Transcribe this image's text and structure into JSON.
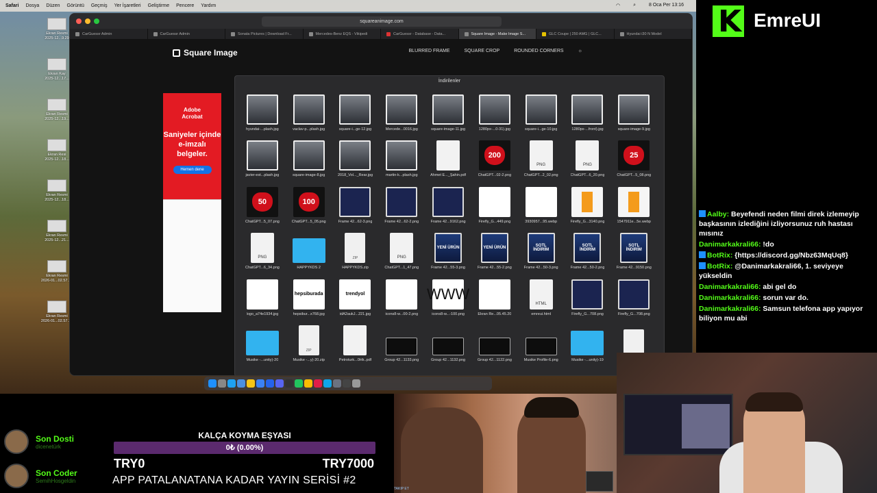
{
  "menubar": {
    "items": [
      "Safari",
      "Dosya",
      "Düzen",
      "Görüntü",
      "Geçmiş",
      "Yer İşaretleri",
      "Geliştirme",
      "Pencere",
      "Yardım"
    ],
    "clock": "8 Oca Per 13:16"
  },
  "desktop_icons": [
    {
      "label": ""
    },
    {
      "label": "Ekran Resmi\n2025-12...9.29"
    },
    {
      "label": "Ekran Kay\n2025-12...17..."
    },
    {
      "label": "Ekran Resmi\n2025-12...19..."
    },
    {
      "label": "Ekran Resi\n2025-12...18..."
    },
    {
      "label": "Ekran Resmi\n2025-12...18..."
    },
    {
      "label": "Ekran Resmi\n2025-12...21..."
    },
    {
      "label": "Ekran Resmi\n2026-01...02.57.19"
    },
    {
      "label": "Ekran Resmi\n2026-01...02.57.16"
    }
  ],
  "browser": {
    "url": "squareanimage.com",
    "tabs": [
      {
        "label": "CarGuessr Admin",
        "active": false
      },
      {
        "label": "CarGuessr Admin",
        "active": false
      },
      {
        "label": "Sonata Pictures | Download Fr...",
        "active": false
      },
      {
        "label": "Mercedes-Benz EQS - Vikipedi",
        "active": false
      },
      {
        "label": "CarGuessr - Database - Data...",
        "active": false
      },
      {
        "label": "Square Image - Make Image S...",
        "active": true
      },
      {
        "label": "GLC Coupe | 250 AMG | GLC...",
        "active": false
      },
      {
        "label": "Hyundai i30 N Model",
        "active": false
      }
    ]
  },
  "site": {
    "logo": "Square Image",
    "nav": [
      "BLURRED FRAME",
      "SQUARE CROP",
      "ROUNDED CORNERS"
    ]
  },
  "ad": {
    "brand": "Adobe\nAcrobat",
    "headline": "Saniyeler içinde e-imzalı belgeler.",
    "cta": "Hemen dene"
  },
  "downloads": {
    "title": "İndirilenler",
    "items": [
      {
        "name": "hyundai-...plash.jpg",
        "kind": "photo"
      },
      {
        "name": "vaclav-p...plash.jpg",
        "kind": "photo"
      },
      {
        "name": "square-i...ge-12.jpg",
        "kind": "photo"
      },
      {
        "name": "Mercede...0016.jpg",
        "kind": "photo"
      },
      {
        "name": "square-image-11.jpg",
        "kind": "photo"
      },
      {
        "name": "1280px-...0-31).jpg",
        "kind": "photo"
      },
      {
        "name": "square-i...ge-10.jpg",
        "kind": "photo"
      },
      {
        "name": "1280px-...front).jpg",
        "kind": "photo"
      },
      {
        "name": "square-image-9.jpg",
        "kind": "photo"
      },
      {
        "name": "javier-est...plash.jpg",
        "kind": "photo"
      },
      {
        "name": "square-image-8.jpg",
        "kind": "photo"
      },
      {
        "name": "2018_Vol..._Rear.jpg",
        "kind": "photo"
      },
      {
        "name": "martin-k...plash.jpg",
        "kind": "photo"
      },
      {
        "name": "Ahmet E..._Şahin.pdf",
        "kind": "doc"
      },
      {
        "name": "ChatGPT...02-2.png",
        "kind": "heart",
        "text": "200"
      },
      {
        "name": "ChatGPT...2_02.png",
        "kind": "doc",
        "text": "PNG"
      },
      {
        "name": "ChatGPT...6_20.png",
        "kind": "doc",
        "text": "PNG"
      },
      {
        "name": "ChatGPT...5_08.png",
        "kind": "heart",
        "text": "25"
      },
      {
        "name": "ChatGPT...5_07.png",
        "kind": "heart",
        "text": "50"
      },
      {
        "name": "ChatGPT...5_05.png",
        "kind": "heart",
        "text": "100"
      },
      {
        "name": "Frame 42...62-3.png",
        "kind": "dark"
      },
      {
        "name": "Frame 42...62-2.png",
        "kind": "dark"
      },
      {
        "name": "Frame 42...9162.png",
        "kind": "dark"
      },
      {
        "name": "Firefly_G...449.png",
        "kind": "white"
      },
      {
        "name": "3930957...95.webp",
        "kind": "white"
      },
      {
        "name": "Firefly_G...3140.png",
        "kind": "orange"
      },
      {
        "name": "1547911e...5e.webp",
        "kind": "orange"
      },
      {
        "name": "ChatGPT...6_34.png",
        "kind": "doc",
        "text": "PNG"
      },
      {
        "name": "HAPPYKDS 2",
        "kind": "folder"
      },
      {
        "name": "HAPPYKDS.zip",
        "kind": "zip",
        "text": "ZIP"
      },
      {
        "name": "ChatGPT...1_47.png",
        "kind": "doc",
        "text": "PNG"
      },
      {
        "name": "Frame 42...55-3.png",
        "kind": "poster",
        "text": "YENİ ÜRÜN"
      },
      {
        "name": "Frame 42...55-2.png",
        "kind": "poster",
        "text": "YENİ ÜRÜN"
      },
      {
        "name": "Frame 42...50-3.png",
        "kind": "poster",
        "text": "SOTL İNDİRİM"
      },
      {
        "name": "Frame 42...50-2.png",
        "kind": "poster",
        "text": "SOTL İNDİRİM"
      },
      {
        "name": "Frame 42...9150.png",
        "kind": "poster",
        "text": "SOTL İNDİRİM"
      },
      {
        "name": "logo_a74e1934.jpg",
        "kind": "white"
      },
      {
        "name": "hepsibur...x768.jpg",
        "kind": "brand",
        "text": "hepsiburada"
      },
      {
        "name": "idA2aukJ...221.jpg",
        "kind": "brand",
        "text": "trendyol"
      },
      {
        "name": "icons8-w...00-2.png",
        "kind": "white"
      },
      {
        "name": "icons8-w...-100.png",
        "kind": "globe",
        "text": "WWW"
      },
      {
        "name": "Ekran Re...05.45.20",
        "kind": "white"
      },
      {
        "name": "emreui.html",
        "kind": "doc",
        "text": "HTML"
      },
      {
        "name": "Firefly_G...708.png",
        "kind": "dark"
      },
      {
        "name": "Firefly_G...708.png",
        "kind": "dark"
      },
      {
        "name": "Musike -...unity)-20",
        "kind": "folder"
      },
      {
        "name": "Musike -...y)-20.zip",
        "kind": "zip",
        "text": "ZIP"
      },
      {
        "name": "Petroturk...0Hk..pdf",
        "kind": "doc"
      },
      {
        "name": "Group 42...1133.png",
        "kind": "screen"
      },
      {
        "name": "Group 42...1132.png",
        "kind": "screen"
      },
      {
        "name": "Group 42...1122.png",
        "kind": "screen"
      },
      {
        "name": "Musike Profile-6.png",
        "kind": "screen"
      },
      {
        "name": "Musike -...unity)-19",
        "kind": "folder"
      },
      {
        "name": "",
        "kind": "zip",
        "text": "ZIP"
      }
    ]
  },
  "stream": {
    "brand": "EmreUI",
    "chat": [
      {
        "user": "Aalby:",
        "text": "Beyefendi neden filmi direk izlemeyip başkasının izlediğini izliyorsunuz ruh hastası mısınız",
        "badge": true
      },
      {
        "user": "Danimarkakrali66:",
        "text": "!do",
        "badge": false
      },
      {
        "user": "BotRix:",
        "text": "{https://discord.gg/Nbz63MqUq8}",
        "badge": true
      },
      {
        "user": "BotRix:",
        "text": "@Danimarkakrali66, 1. seviyeye yükseldin",
        "badge": true
      },
      {
        "user": "Danimarkakrali66:",
        "text": "abi gel do",
        "badge": false
      },
      {
        "user": "Danimarkakrali66:",
        "text": "sorun var do.",
        "badge": false
      },
      {
        "user": "Danimarkakrali66:",
        "text": "Samsun telefona app yapıyor biliyon mu abi",
        "badge": false
      }
    ],
    "last_follow": {
      "label": "Son Dosti",
      "user": "dicenetürk"
    },
    "last_sub": {
      "label": "Son Coder",
      "user": "SemihHosgeldin"
    },
    "goal": {
      "title": "KALÇA KOYMA EŞYASI",
      "progress_text": "0₺ (0.00%)",
      "progress": 0,
      "min": "TRY0",
      "max": "TRY7000"
    },
    "series": "APP PATALANATANA KADAR YAYIN SERİSİ #2",
    "video_tag": "TAKIP ET"
  },
  "colors": {
    "accent": "#53fc18",
    "ad_red": "#e31b23",
    "goal_bar": "#5b2a6e"
  }
}
